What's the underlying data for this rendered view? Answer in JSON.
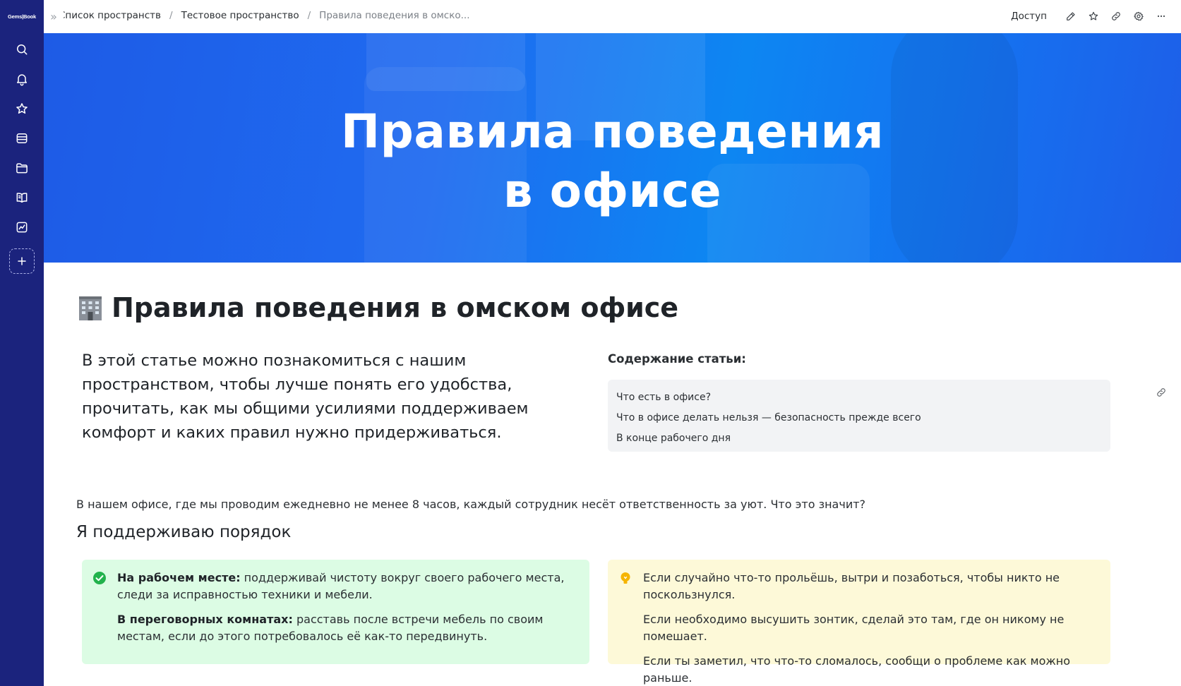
{
  "app": {
    "logo_text": "Gems|Book"
  },
  "sidebar": {
    "items": [
      {
        "icon": "search-icon"
      },
      {
        "icon": "bell-icon"
      },
      {
        "icon": "star-icon"
      },
      {
        "icon": "inbox-icon"
      },
      {
        "icon": "folder-icon"
      },
      {
        "icon": "book-icon"
      },
      {
        "icon": "chart-icon"
      },
      {
        "icon": "plus-icon"
      }
    ]
  },
  "topbar": {
    "collapse_glyph": "»",
    "breadcrumb": [
      "Список пространств",
      "Тестовое пространство",
      "Правила поведения в омско..."
    ],
    "separator": "/",
    "access_label": "Доступ"
  },
  "banner": {
    "line1": "Правила поведения",
    "line2": "в офисе"
  },
  "page": {
    "title": "Правила поведения в омском офисе",
    "intro": "В этой статье можно познакомиться с нашим пространством, чтобы лучше понять его удобства, прочитать, как мы общими усилиями поддерживаем комфорт и каких правил нужно придерживаться.",
    "toc_title": "Содержание статьи:",
    "toc": [
      "Что есть в офисе?",
      "Что в офисе делать нельзя — безопасность прежде всего",
      "В конце рабочего дня"
    ],
    "paragraph": "В нашем офисе, где мы проводим ежедневно не менее 8 часов, каждый сотрудник несёт ответственность за уют. Что это значит?",
    "section_heading": "Я поддерживаю порядок"
  },
  "cards": {
    "green": [
      {
        "label": "На рабочем месте:",
        "text": " поддерживай чистоту вокруг своего рабочего места, следи за исправностью техники и мебели."
      },
      {
        "label": "В переговорных комнатах:",
        "text": " расставь после встречи мебель по своим местам, если до этого потребовалось её как-то передвинуть."
      }
    ],
    "yellow": [
      "Если случайно что-то прольёшь, вытри и позаботься, чтобы никто не поскользнулся.",
      "Если необходимо высушить зонтик, сделай это там, где он никому не помешает.",
      "Если ты заметил, что что-то сломалось, сообщи о проблеме как можно раньше."
    ]
  },
  "colors": {
    "sidebar": "#1b237d",
    "banner_primary": "#1f6bf0",
    "green_card": "#dcfce4",
    "yellow_card": "#fdf9d8",
    "success_icon": "#22b24c",
    "tip_icon": "#f5b400"
  }
}
